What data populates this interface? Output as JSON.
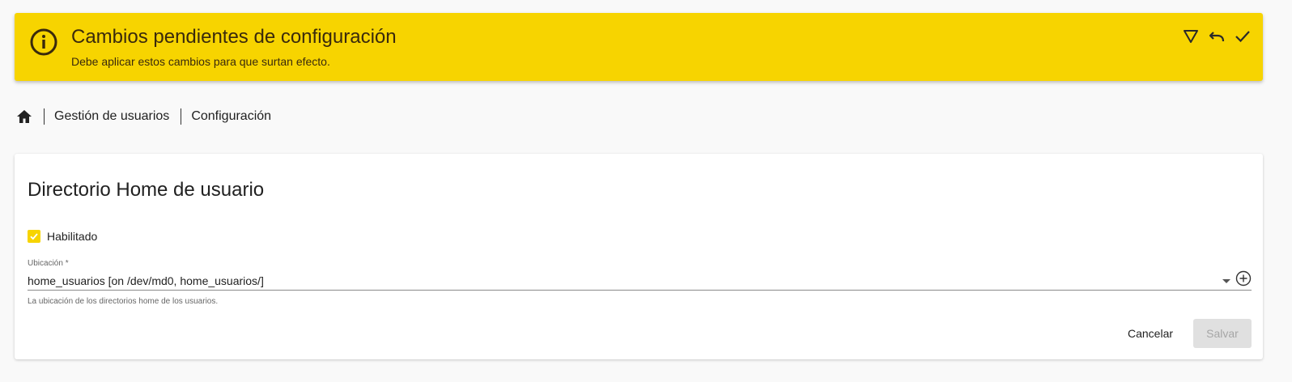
{
  "banner": {
    "icon": "info-icon",
    "title": "Cambios pendientes de configuración",
    "subtitle": "Debe aplicar estos cambios para que surtan efecto.",
    "actions": [
      "filter-icon",
      "undo-icon",
      "check-icon"
    ],
    "background_color": "#f7d400"
  },
  "breadcrumb": {
    "home_icon": "home-icon",
    "items": [
      "Gestión de usuarios",
      "Configuración"
    ]
  },
  "card": {
    "title": "Directorio Home de usuario",
    "enabled": {
      "label": "Habilitado",
      "checked": true
    },
    "location": {
      "label": "Ubicación *",
      "value": "home_usuarios [on /dev/md0, home_usuarios/]",
      "hint": "La ubicación de los directorios home de los usuarios."
    },
    "buttons": {
      "cancel": "Cancelar",
      "save": "Salvar",
      "save_disabled": true
    }
  }
}
